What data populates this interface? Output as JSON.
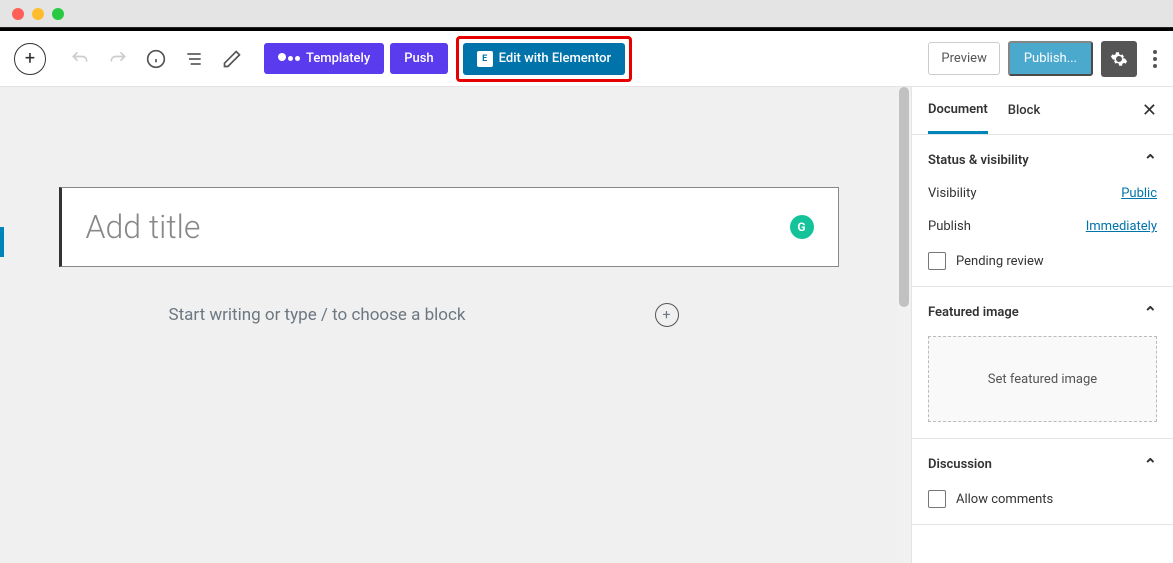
{
  "toolbar": {
    "templately_label": "Templately",
    "push_label": "Push",
    "elementor_label": "Edit with Elementor",
    "preview_label": "Preview",
    "publish_label": "Publish..."
  },
  "editor": {
    "title_placeholder": "Add title",
    "body_placeholder": "Start writing or type / to choose a block"
  },
  "sidebar": {
    "tabs": {
      "document": "Document",
      "block": "Block"
    },
    "status": {
      "header": "Status & visibility",
      "visibility_label": "Visibility",
      "visibility_value": "Public",
      "publish_label": "Publish",
      "publish_value": "Immediately",
      "pending_label": "Pending review"
    },
    "featured": {
      "header": "Featured image",
      "placeholder": "Set featured image"
    },
    "discussion": {
      "header": "Discussion",
      "allow_comments": "Allow comments"
    }
  }
}
